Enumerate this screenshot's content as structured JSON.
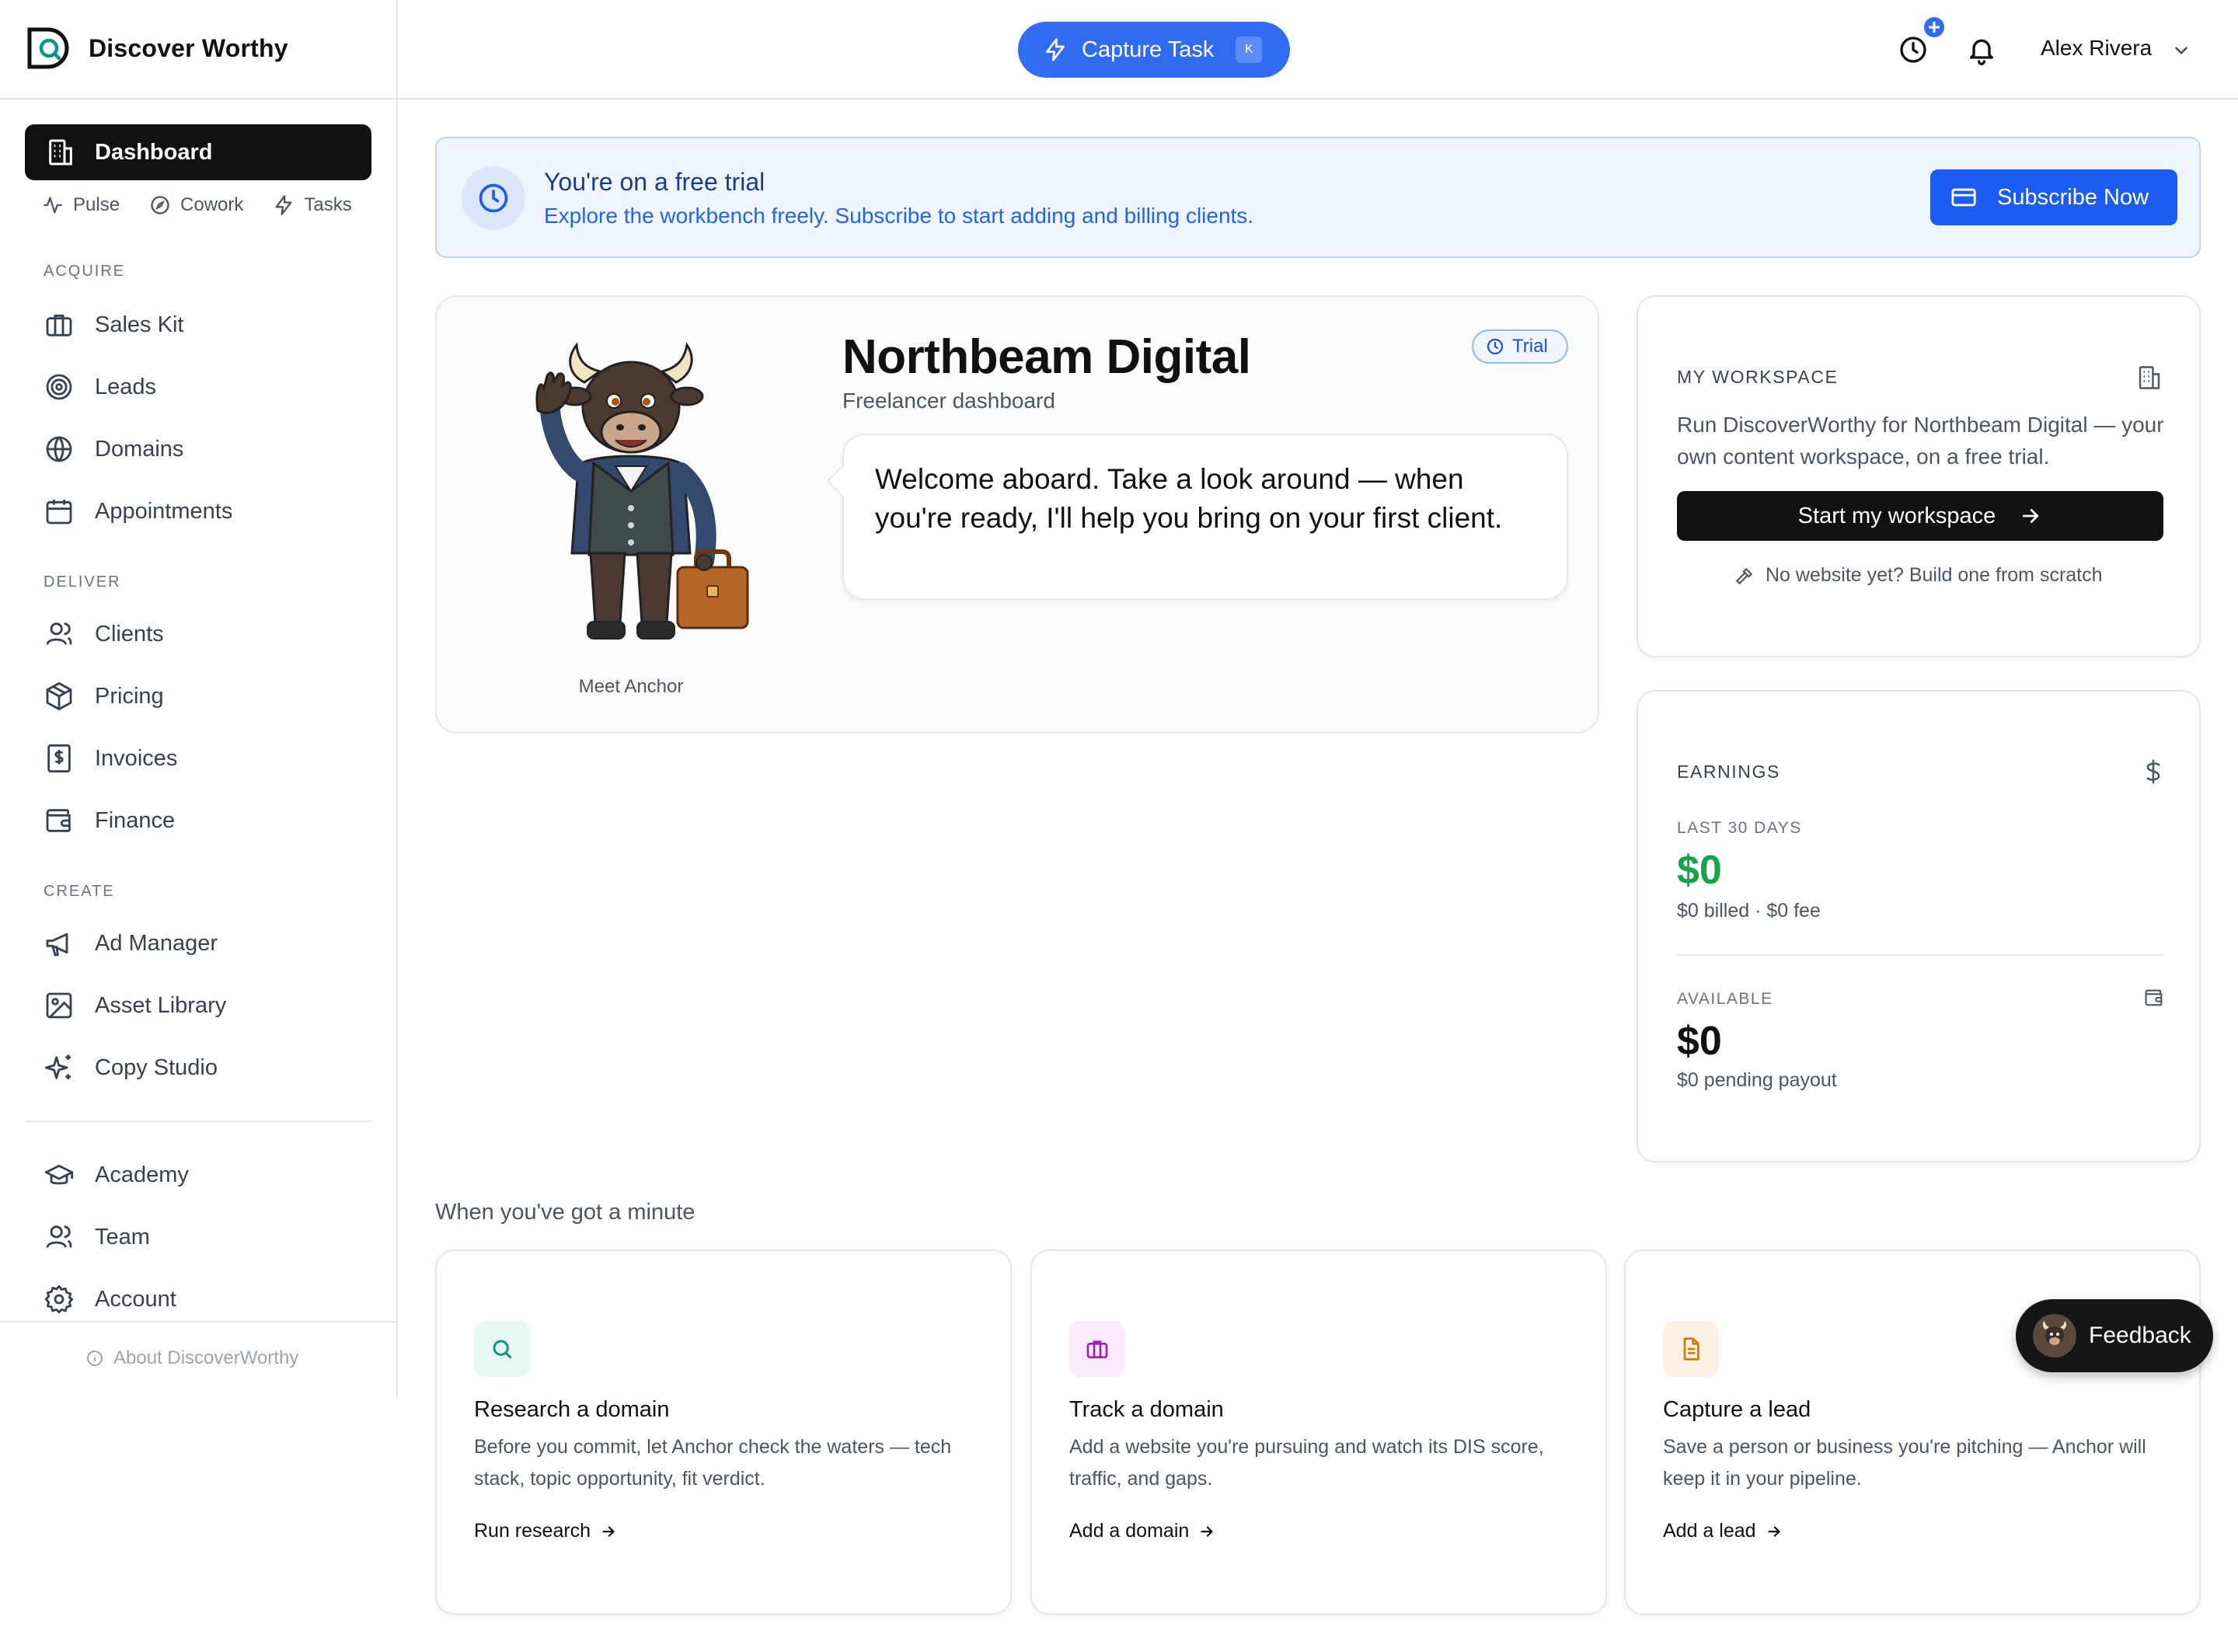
{
  "app": {
    "name": "Discover Worthy",
    "capture_label": "Capture Task",
    "capture_shortcut": "K",
    "user_name": "Alex Rivera"
  },
  "sidebar": {
    "dashboard_label": "Dashboard",
    "subnav": [
      {
        "label": "Pulse",
        "icon": "pulse-icon"
      },
      {
        "label": "Cowork",
        "icon": "compass-icon"
      },
      {
        "label": "Tasks",
        "icon": "bolt-icon"
      }
    ],
    "sections": {
      "acquire": "ACQUIRE",
      "deliver": "DELIVER",
      "create": "CREATE"
    },
    "items": {
      "sales_kit": "Sales Kit",
      "leads": "Leads",
      "domains": "Domains",
      "appointments": "Appointments",
      "clients": "Clients",
      "pricing": "Pricing",
      "invoices": "Invoices",
      "finance": "Finance",
      "ad_manager": "Ad Manager",
      "asset_library": "Asset Library",
      "copy_studio": "Copy Studio",
      "academy": "Academy",
      "team": "Team",
      "account": "Account"
    },
    "about": "About DiscoverWorthy"
  },
  "banner": {
    "title": "You're on a free trial",
    "subtitle": "Explore the workbench freely. Subscribe to start adding and billing clients.",
    "button": "Subscribe Now"
  },
  "hero": {
    "title": "Northbeam Digital",
    "subtitle": "Freelancer dashboard",
    "badge": "Trial",
    "message": "Welcome aboard. Take a look around — when you're ready, I'll help you bring on your first client.",
    "mascot_caption": "Meet Anchor"
  },
  "workspace": {
    "label": "MY WORKSPACE",
    "description": "Run DiscoverWorthy for Northbeam Digital — your own content workspace, on a free trial.",
    "button": "Start my workspace",
    "link": "No website yet? Build one from scratch"
  },
  "earnings": {
    "label": "EARNINGS",
    "period_label": "LAST 30 DAYS",
    "period_amount": "$0",
    "period_detail": "$0 billed · $0 fee",
    "available_label": "AVAILABLE",
    "available_amount": "$0",
    "available_detail": "$0 pending payout"
  },
  "quick_actions": {
    "heading": "When you've got a minute",
    "cards": [
      {
        "title": "Research a domain",
        "description": "Before you commit, let Anchor check the waters — tech stack, topic opportunity, fit verdict.",
        "link": "Run research",
        "icon": "search-icon",
        "color": "#0d9488"
      },
      {
        "title": "Track a domain",
        "description": "Add a website you're pursuing and watch its DIS score, traffic, and gaps.",
        "link": "Add a domain",
        "icon": "briefcase-icon",
        "color": "#a21caf"
      },
      {
        "title": "Capture a lead",
        "description": "Save a person or business you're pitching — Anchor will keep it in your pipeline.",
        "link": "Add a lead",
        "icon": "document-icon",
        "color": "#d97706"
      }
    ]
  },
  "feedback": {
    "label": "Feedback"
  },
  "colors": {
    "accent": "#2f6cf2",
    "subscribe": "#1d5cf0",
    "earnings_green": "#16a34a",
    "dark": "#111111"
  }
}
